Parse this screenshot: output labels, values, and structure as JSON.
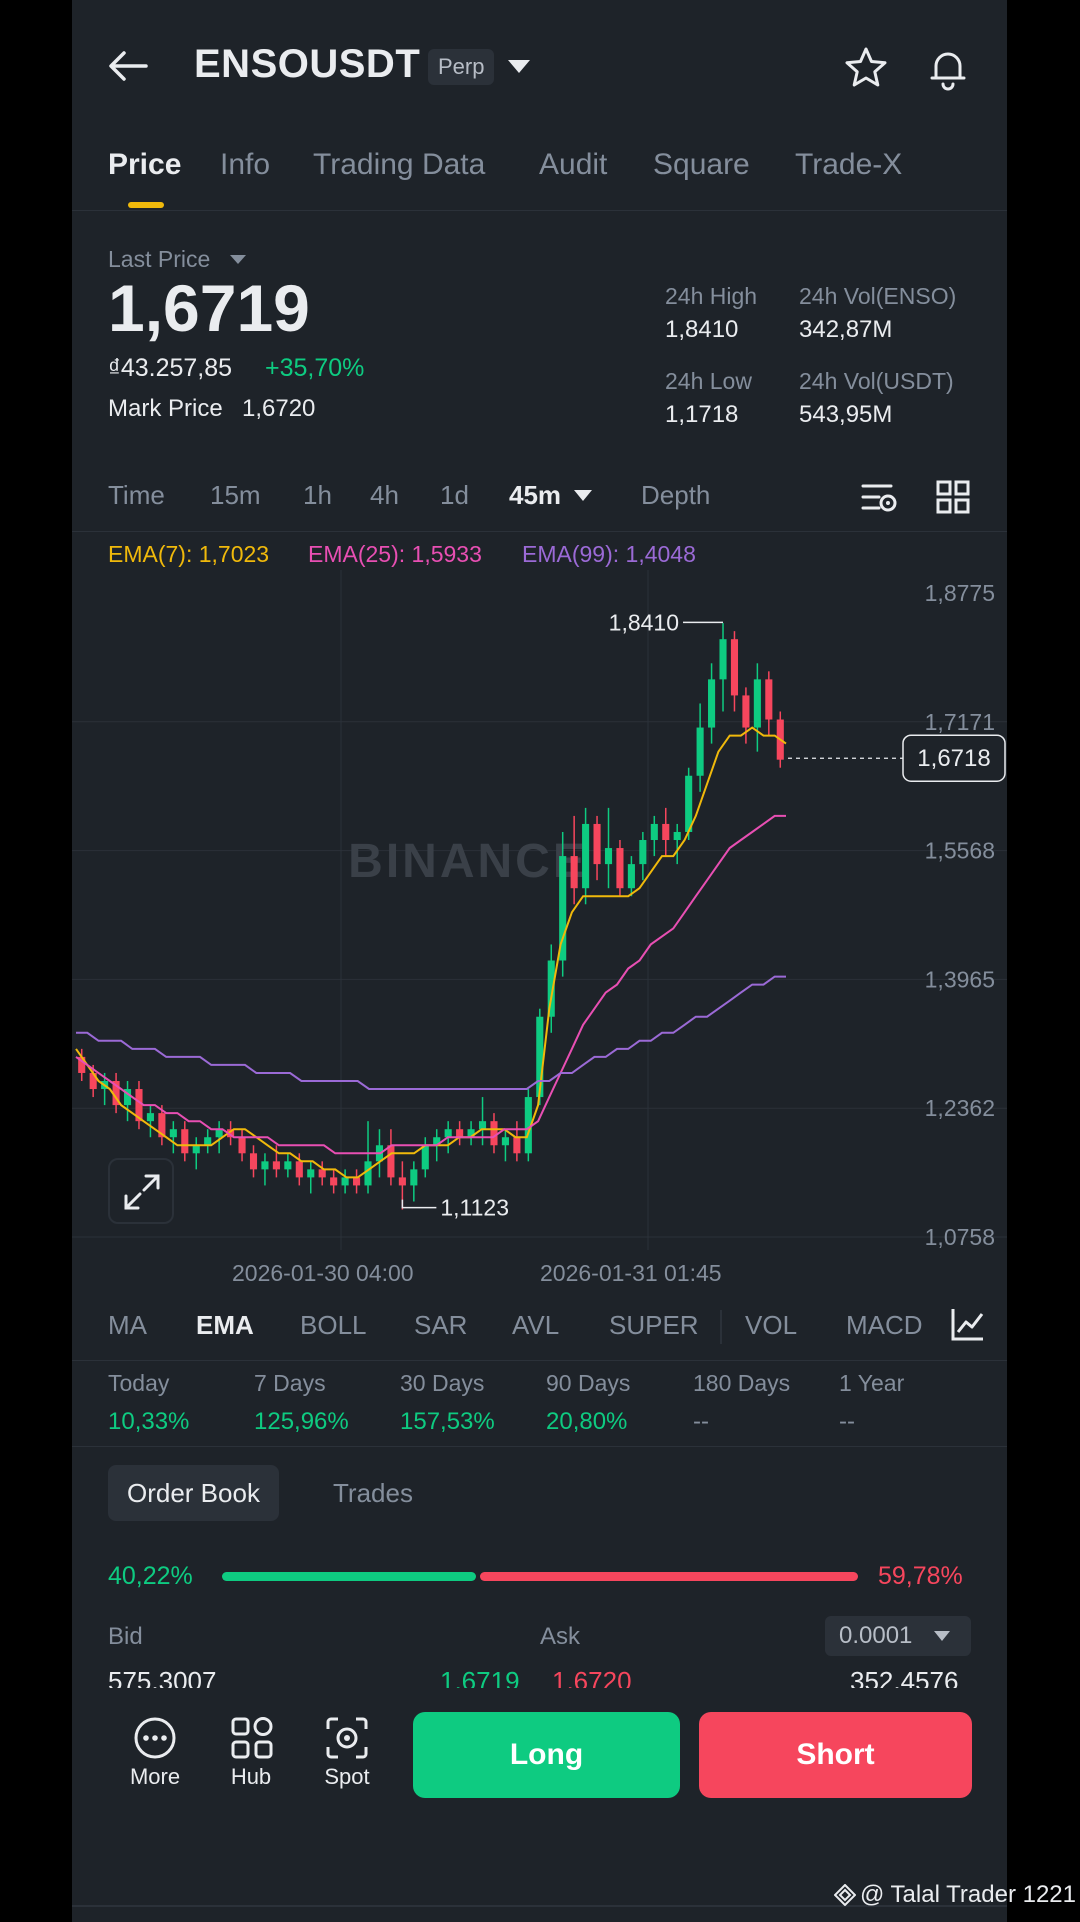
{
  "header": {
    "symbol": "ENSOUSDT",
    "badge": "Perp",
    "icons": [
      "back-arrow-icon",
      "chevron-down-icon",
      "star-icon",
      "bell-icon"
    ]
  },
  "tabs": [
    {
      "label": "Price",
      "active": true
    },
    {
      "label": "Info"
    },
    {
      "label": "Trading Data"
    },
    {
      "label": "Audit"
    },
    {
      "label": "Square"
    },
    {
      "label": "Trade-X"
    }
  ],
  "price": {
    "label": "Last Price",
    "last": "1,6719",
    "fiat": "₫43.257,85",
    "change": "+35,70%",
    "mark_label": "Mark Price",
    "mark_value": "1,6720"
  },
  "stats": {
    "high_label": "24h High",
    "high": "1,8410",
    "vol_base_label": "24h Vol(ENSO)",
    "vol_base": "342,87M",
    "low_label": "24h Low",
    "low": "1,1718",
    "vol_quote_label": "24h Vol(USDT)",
    "vol_quote": "543,95M"
  },
  "intervals": {
    "time": "Time",
    "m15": "15m",
    "h1": "1h",
    "h4": "4h",
    "d1": "1d",
    "selected": "45m",
    "depth": "Depth"
  },
  "ema": {
    "ema7": "EMA(7): 1,7023",
    "ema25": "EMA(25): 1,5933",
    "ema99": "EMA(99): 1,4048"
  },
  "chart_data": {
    "type": "candlestick",
    "watermark": "BINANCE",
    "y_ticks": [
      "1,8775",
      "1,7171",
      "1,5568",
      "1,3965",
      "1,2362",
      "1,0758"
    ],
    "ylim": [
      1.0758,
      1.8775
    ],
    "x_ticks": [
      "2026-01-30 04:00",
      "2026-01-31 01:45"
    ],
    "current_price_label": "1,6718",
    "current_price": 1.6718,
    "high_annotation": "1,8410",
    "high": 1.841,
    "low_annotation": "1,1123",
    "low": 1.1123,
    "colors": {
      "up": "#0ecb81",
      "down": "#f6465d",
      "ema7": "#f0b90b",
      "ema25": "#e84fb3",
      "ema99": "#9b6ad6"
    },
    "series": [
      {
        "name": "EMA(7)",
        "values": [
          1.31,
          1.29,
          1.27,
          1.26,
          1.24,
          1.23,
          1.22,
          1.21,
          1.2,
          1.19,
          1.19,
          1.19,
          1.19,
          1.2,
          1.21,
          1.21,
          1.2,
          1.19,
          1.18,
          1.18,
          1.17,
          1.17,
          1.16,
          1.16,
          1.15,
          1.15,
          1.16,
          1.17,
          1.18,
          1.18,
          1.18,
          1.19,
          1.19,
          1.19,
          1.2,
          1.2,
          1.21,
          1.21,
          1.21,
          1.2,
          1.2,
          1.24,
          1.36,
          1.44,
          1.48,
          1.5,
          1.5,
          1.5,
          1.5,
          1.5,
          1.51,
          1.53,
          1.55,
          1.55,
          1.57,
          1.6,
          1.64,
          1.68,
          1.7,
          1.7,
          1.71,
          1.7,
          1.7,
          1.69
        ]
      },
      {
        "name": "EMA(25)",
        "values": [
          1.3,
          1.29,
          1.28,
          1.27,
          1.26,
          1.25,
          1.24,
          1.24,
          1.23,
          1.23,
          1.22,
          1.22,
          1.21,
          1.21,
          1.2,
          1.2,
          1.2,
          1.2,
          1.19,
          1.19,
          1.19,
          1.19,
          1.19,
          1.18,
          1.18,
          1.18,
          1.18,
          1.18,
          1.19,
          1.19,
          1.19,
          1.19,
          1.19,
          1.2,
          1.2,
          1.2,
          1.2,
          1.2,
          1.21,
          1.21,
          1.21,
          1.22,
          1.25,
          1.28,
          1.31,
          1.34,
          1.36,
          1.38,
          1.39,
          1.41,
          1.42,
          1.44,
          1.45,
          1.46,
          1.48,
          1.5,
          1.52,
          1.54,
          1.56,
          1.57,
          1.58,
          1.59,
          1.6,
          1.6
        ]
      },
      {
        "name": "EMA(99)",
        "values": [
          1.33,
          1.33,
          1.32,
          1.32,
          1.32,
          1.31,
          1.31,
          1.31,
          1.3,
          1.3,
          1.3,
          1.3,
          1.29,
          1.29,
          1.29,
          1.29,
          1.28,
          1.28,
          1.28,
          1.28,
          1.27,
          1.27,
          1.27,
          1.27,
          1.27,
          1.27,
          1.26,
          1.26,
          1.26,
          1.26,
          1.26,
          1.26,
          1.26,
          1.26,
          1.26,
          1.26,
          1.26,
          1.26,
          1.26,
          1.26,
          1.26,
          1.27,
          1.27,
          1.28,
          1.28,
          1.29,
          1.3,
          1.3,
          1.31,
          1.31,
          1.32,
          1.32,
          1.33,
          1.33,
          1.34,
          1.35,
          1.35,
          1.36,
          1.37,
          1.38,
          1.39,
          1.39,
          1.4,
          1.4
        ]
      }
    ],
    "candles": [
      [
        1.3,
        1.31,
        1.27,
        1.28
      ],
      [
        1.28,
        1.29,
        1.25,
        1.26
      ],
      [
        1.26,
        1.28,
        1.24,
        1.27
      ],
      [
        1.27,
        1.28,
        1.23,
        1.24
      ],
      [
        1.24,
        1.27,
        1.22,
        1.26
      ],
      [
        1.26,
        1.27,
        1.21,
        1.22
      ],
      [
        1.22,
        1.24,
        1.2,
        1.23
      ],
      [
        1.23,
        1.24,
        1.19,
        1.2
      ],
      [
        1.2,
        1.22,
        1.18,
        1.21
      ],
      [
        1.21,
        1.22,
        1.17,
        1.18
      ],
      [
        1.18,
        1.2,
        1.16,
        1.19
      ],
      [
        1.19,
        1.21,
        1.18,
        1.2
      ],
      [
        1.2,
        1.22,
        1.18,
        1.21
      ],
      [
        1.21,
        1.22,
        1.19,
        1.2
      ],
      [
        1.2,
        1.21,
        1.17,
        1.18
      ],
      [
        1.18,
        1.19,
        1.15,
        1.16
      ],
      [
        1.16,
        1.18,
        1.14,
        1.17
      ],
      [
        1.17,
        1.19,
        1.15,
        1.16
      ],
      [
        1.16,
        1.18,
        1.15,
        1.17
      ],
      [
        1.17,
        1.18,
        1.14,
        1.15
      ],
      [
        1.15,
        1.17,
        1.13,
        1.16
      ],
      [
        1.16,
        1.17,
        1.14,
        1.15
      ],
      [
        1.15,
        1.16,
        1.13,
        1.14
      ],
      [
        1.14,
        1.16,
        1.13,
        1.15
      ],
      [
        1.15,
        1.16,
        1.13,
        1.14
      ],
      [
        1.14,
        1.22,
        1.13,
        1.17
      ],
      [
        1.17,
        1.21,
        1.15,
        1.19
      ],
      [
        1.19,
        1.21,
        1.14,
        1.15
      ],
      [
        1.15,
        1.17,
        1.11,
        1.14
      ],
      [
        1.14,
        1.17,
        1.12,
        1.16
      ],
      [
        1.16,
        1.2,
        1.15,
        1.19
      ],
      [
        1.19,
        1.21,
        1.17,
        1.2
      ],
      [
        1.2,
        1.22,
        1.18,
        1.21
      ],
      [
        1.21,
        1.22,
        1.19,
        1.2
      ],
      [
        1.2,
        1.22,
        1.19,
        1.21
      ],
      [
        1.21,
        1.25,
        1.19,
        1.22
      ],
      [
        1.22,
        1.23,
        1.18,
        1.19
      ],
      [
        1.19,
        1.21,
        1.17,
        1.2
      ],
      [
        1.2,
        1.22,
        1.17,
        1.18
      ],
      [
        1.18,
        1.26,
        1.17,
        1.25
      ],
      [
        1.25,
        1.36,
        1.24,
        1.35
      ],
      [
        1.35,
        1.44,
        1.33,
        1.42
      ],
      [
        1.42,
        1.58,
        1.4,
        1.55
      ],
      [
        1.55,
        1.6,
        1.49,
        1.51
      ],
      [
        1.51,
        1.61,
        1.49,
        1.59
      ],
      [
        1.59,
        1.6,
        1.52,
        1.54
      ],
      [
        1.54,
        1.61,
        1.51,
        1.56
      ],
      [
        1.56,
        1.57,
        1.5,
        1.51
      ],
      [
        1.51,
        1.55,
        1.5,
        1.54
      ],
      [
        1.54,
        1.58,
        1.52,
        1.57
      ],
      [
        1.57,
        1.6,
        1.55,
        1.59
      ],
      [
        1.59,
        1.61,
        1.55,
        1.57
      ],
      [
        1.57,
        1.59,
        1.54,
        1.58
      ],
      [
        1.58,
        1.66,
        1.57,
        1.65
      ],
      [
        1.65,
        1.74,
        1.63,
        1.71
      ],
      [
        1.71,
        1.79,
        1.69,
        1.77
      ],
      [
        1.77,
        1.84,
        1.73,
        1.82
      ],
      [
        1.82,
        1.83,
        1.73,
        1.75
      ],
      [
        1.75,
        1.76,
        1.69,
        1.71
      ],
      [
        1.71,
        1.79,
        1.68,
        1.77
      ],
      [
        1.77,
        1.78,
        1.7,
        1.72
      ],
      [
        1.72,
        1.73,
        1.66,
        1.67
      ]
    ]
  },
  "indicators": {
    "ma": "MA",
    "ema": "EMA",
    "boll": "BOLL",
    "sar": "SAR",
    "avl": "AVL",
    "super": "SUPER",
    "vol": "VOL",
    "macd": "MACD",
    "icon": "indicator-settings-icon"
  },
  "performance": [
    {
      "label": "Today",
      "value": "10,33%"
    },
    {
      "label": "7 Days",
      "value": "125,96%"
    },
    {
      "label": "30 Days",
      "value": "157,53%"
    },
    {
      "label": "90 Days",
      "value": "20,80%"
    },
    {
      "label": "180 Days",
      "value": "--"
    },
    {
      "label": "1 Year",
      "value": "--"
    }
  ],
  "order_book": {
    "tab_book": "Order Book",
    "tab_trades": "Trades",
    "bid_pct": "40,22%",
    "bid_ratio": 0.4022,
    "ask_pct": "59,78%",
    "bid_label": "Bid",
    "ask_label": "Ask",
    "precision": "0.0001",
    "row": {
      "bid_qty": "575,3007",
      "bid_price": "1,6719",
      "ask_price": "1,6720",
      "ask_qty": "352,4576"
    }
  },
  "bottom": {
    "more": "More",
    "hub": "Hub",
    "spot": "Spot",
    "long": "Long",
    "short": "Short"
  },
  "watermark": "@ Talal Trader 1221"
}
